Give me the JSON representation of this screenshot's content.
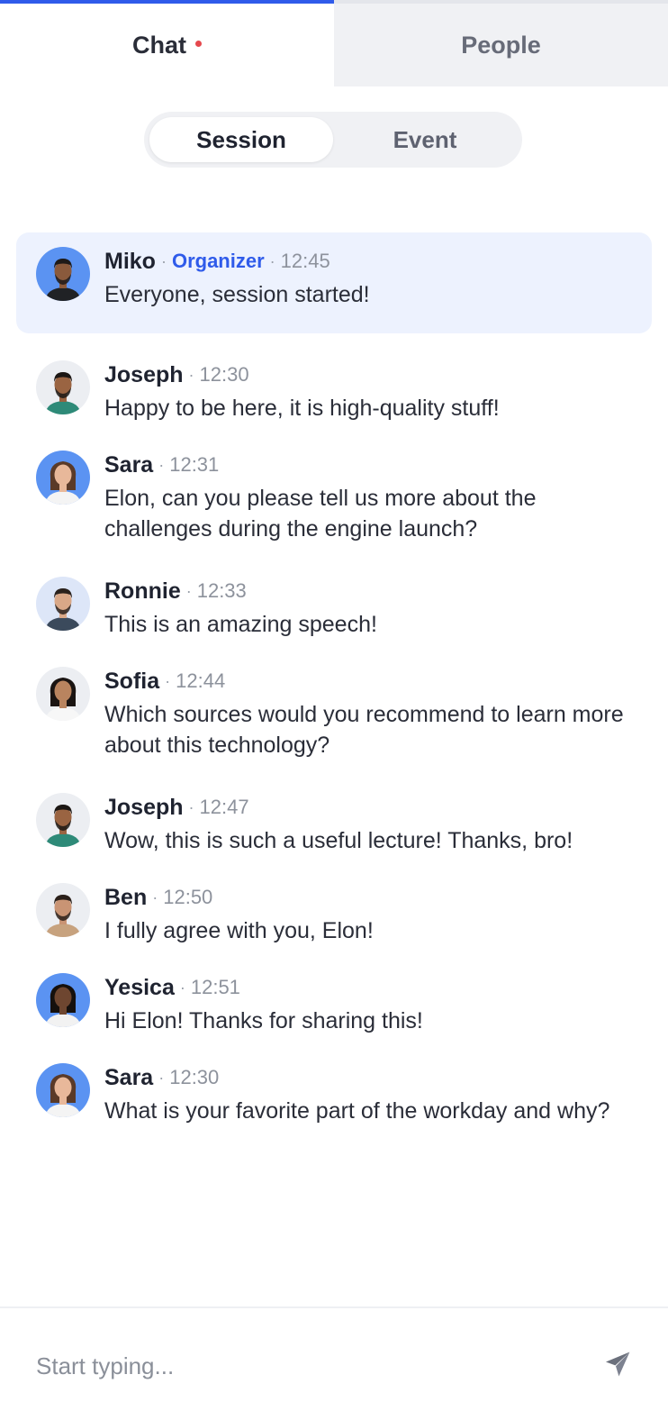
{
  "tabs": {
    "chat": {
      "label": "Chat",
      "indicator_color": "#e5484d"
    },
    "people": {
      "label": "People"
    }
  },
  "segment": {
    "session_label": "Session",
    "event_label": "Event"
  },
  "colors": {
    "accent": "#2f5bea",
    "organizer": "#2f5bea",
    "highlight_bg": "#edf2fe",
    "avatar_blue": "#5b93f2",
    "avatar_light": "#eceef2"
  },
  "messages": [
    {
      "name": "Miko",
      "role": "Organizer",
      "time": "12:45",
      "text": "Everyone, session started!",
      "highlight": true,
      "avatar": "miko-avatar"
    },
    {
      "name": "Joseph",
      "role": "",
      "time": "12:30",
      "text": "Happy to be here, it is high-quality stuff!",
      "highlight": false,
      "avatar": "joseph-avatar"
    },
    {
      "name": "Sara",
      "role": "",
      "time": "12:31",
      "text": "Elon, can you please tell us more about the challenges during the engine launch?",
      "highlight": false,
      "avatar": "sara-avatar"
    },
    {
      "name": "Ronnie",
      "role": "",
      "time": "12:33",
      "text": "This is an amazing speech!",
      "highlight": false,
      "avatar": "ronnie-avatar"
    },
    {
      "name": "Sofia",
      "role": "",
      "time": "12:44",
      "text": "Which sources would you recommend to learn more about this technology?",
      "highlight": false,
      "avatar": "sofia-avatar"
    },
    {
      "name": "Joseph",
      "role": "",
      "time": "12:47",
      "text": "Wow, this is such a useful lecture! Thanks, bro!",
      "highlight": false,
      "avatar": "joseph-avatar"
    },
    {
      "name": "Ben",
      "role": "",
      "time": "12:50",
      "text": "I fully agree with you, Elon!",
      "highlight": false,
      "avatar": "ben-avatar"
    },
    {
      "name": "Yesica",
      "role": "",
      "time": "12:51",
      "text": "Hi Elon! Thanks for sharing this!",
      "highlight": false,
      "avatar": "yesica-avatar"
    },
    {
      "name": "Sara",
      "role": "",
      "time": "12:30",
      "text": "What is your favorite part of the workday and why?",
      "highlight": false,
      "avatar": "sara-avatar"
    }
  ],
  "composer": {
    "placeholder": "Start typing...",
    "value": "",
    "send_icon": "send-icon"
  }
}
